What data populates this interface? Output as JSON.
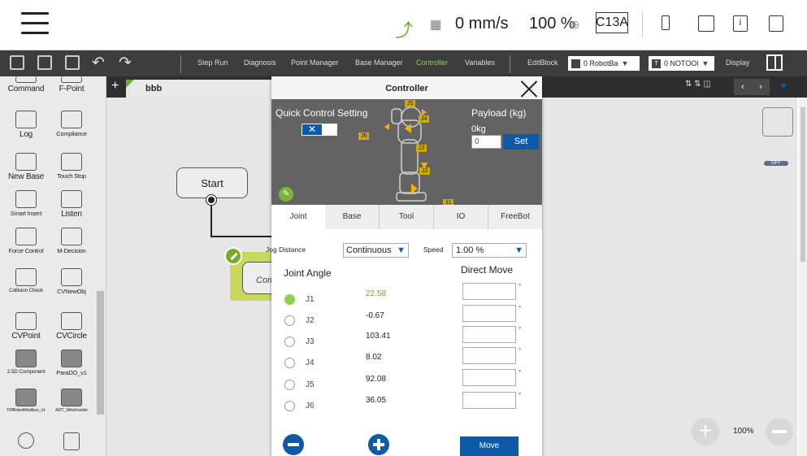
{
  "statusbar": {
    "speed": "0 mm/s",
    "speed_percent": "100 %",
    "mode": "C13A"
  },
  "toolbar": {
    "items": [
      "Step Run",
      "Diagnosis",
      "Point Manager",
      "Base Manager",
      "Controller",
      "Variables",
      "EditBlock"
    ],
    "active_item": "Controller",
    "base_select": "0 RobotBa",
    "tool_select": "0 NOTOOl",
    "tool_icon_letter": "T",
    "display_label": "Display"
  },
  "left_panel": {
    "items": [
      {
        "label": "Command"
      },
      {
        "label": "F-Point"
      },
      {
        "label": "Log"
      },
      {
        "label": "Compliance"
      },
      {
        "label": "New Base"
      },
      {
        "label": "Touch Stop"
      },
      {
        "label": "Smart Insert"
      },
      {
        "label": "Listen"
      },
      {
        "label": "Force Control"
      },
      {
        "label": "M-Decision"
      },
      {
        "label": "Collision Check"
      },
      {
        "label": "CVNewObj"
      },
      {
        "label": "CVPoint"
      },
      {
        "label": "CVCircle"
      },
      {
        "label": "2.5D Component"
      },
      {
        "label": "ParaDO_v1"
      },
      {
        "label": "TMRobotModbus_v1"
      },
      {
        "label": "ADT_WireFeeder"
      }
    ]
  },
  "flow": {
    "tab_plus": "+",
    "tab_name": "bbb",
    "start_label": "Start",
    "component_label": "Comp",
    "zoom": "100%"
  },
  "controller": {
    "title": "Controller",
    "quick_control_label": "Quick Control Setting",
    "toggle_x": "✕",
    "payload_label": "Payload (kg)",
    "payload_value": "0kg",
    "payload_input": "0",
    "set_button": "Set",
    "joint_tags": [
      "J1",
      "J2",
      "J3",
      "J4",
      "J5",
      "J6"
    ],
    "tabs": [
      "Joint",
      "Base",
      "Tool",
      "IO",
      "FreeBot"
    ],
    "active_tab": "Joint",
    "jog_distance_label": "Jog Distance",
    "jog_distance_value": "Continuous",
    "speed_label": "Speed",
    "speed_value": "1.00 %",
    "joint_angle_label": "Joint Angle",
    "direct_move_label": "Direct Move",
    "degree_symbol": "°",
    "joints": [
      {
        "name": "J1",
        "value": "22.58",
        "selected": true
      },
      {
        "name": "J2",
        "value": "-0.67",
        "selected": false
      },
      {
        "name": "J3",
        "value": "103.41",
        "selected": false
      },
      {
        "name": "J4",
        "value": "8.02",
        "selected": false
      },
      {
        "name": "J5",
        "value": "92.08",
        "selected": false
      },
      {
        "name": "J6",
        "value": "36.05",
        "selected": false
      }
    ],
    "move_button": "Move"
  },
  "colors": {
    "accent_blue": "#0c5aa8",
    "accent_green": "#8fd14f",
    "toolbar_bg": "#3d3d3d"
  }
}
